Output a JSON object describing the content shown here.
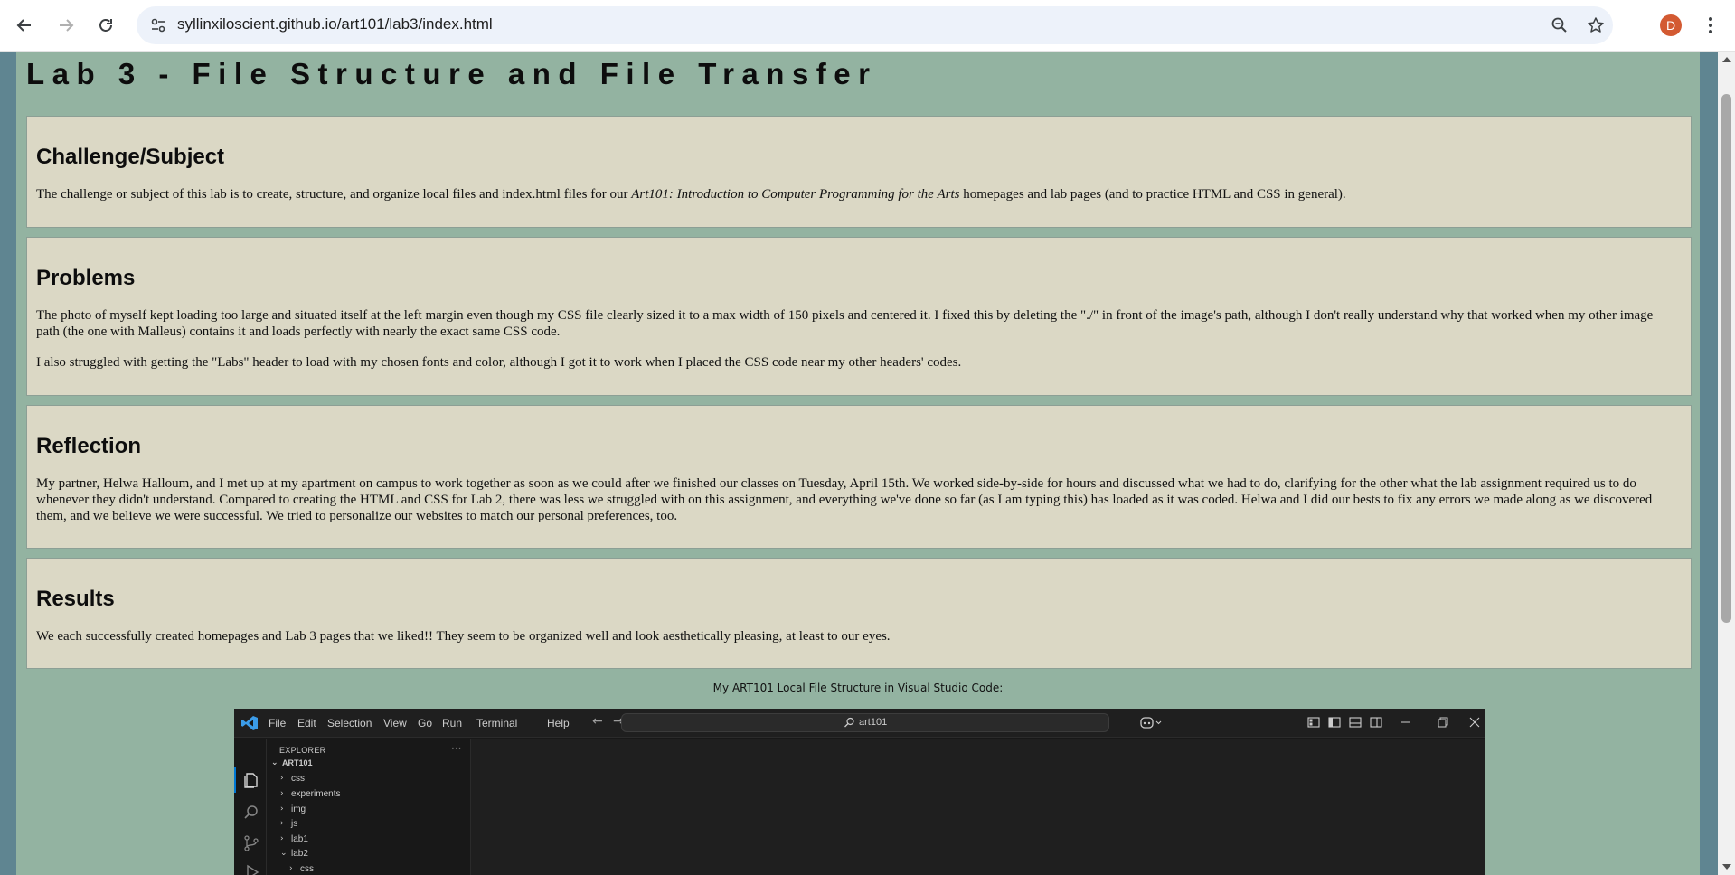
{
  "browser": {
    "url": "syllinxiloscient.github.io/art101/lab3/index.html",
    "profile_initial": "D",
    "icons": {
      "back": "arrow-back-icon",
      "forward": "arrow-forward-icon",
      "reload": "reload-icon",
      "site_info": "tune-icon",
      "zoom": "zoom-icon",
      "bookmark": "star-icon",
      "menu": "kebab-menu-icon"
    }
  },
  "page": {
    "title": "Lab 3 - File Structure and File Transfer",
    "colors": {
      "background": "#93b3a1",
      "section": "#dbd8c5",
      "outer": "#5f8591"
    },
    "sections": [
      {
        "heading": "Challenge/Subject",
        "paragraphs": [
          {
            "before": "The challenge or subject of this lab is to create, structure, and organize local files and index.html files for our ",
            "emphasis": "Art101: Introduction to Computer Programming for the Arts",
            "after": " homepages and lab pages (and to practice HTML and CSS in general)."
          }
        ]
      },
      {
        "heading": "Problems",
        "paragraphs": [
          "The photo of myself kept loading too large and situated itself at the left margin even though my CSS file clearly sized it to a max width of 150 pixels and centered it. I fixed this by deleting the \"./\" in front of the image's path, although I don't really understand why that worked when my other image path (the one with Malleus) contains it and loads perfectly with nearly the exact same CSS code.",
          "I also struggled with getting the \"Labs\" header to load with my chosen fonts and color, although I got it to work when I placed the CSS code near my other headers' codes."
        ]
      },
      {
        "heading": "Reflection",
        "paragraphs": [
          "My partner, Helwa Halloum, and I met up at my apartment on campus to work together as soon as we could after we finished our classes on Tuesday, April 15th. We worked side-by-side for hours and discussed what we had to do, clarifying for the other what the lab assignment required us to do whenever they didn't understand. Compared to creating the HTML and CSS for Lab 2, there was less we struggled with on this assignment, and everything we've done so far (as I am typing this) has loaded as it was coded. Helwa and I did our bests to fix any errors we made along as we discovered them, and we believe we were successful. We tried to personalize our websites to match our personal preferences, too."
        ]
      },
      {
        "heading": "Results",
        "paragraphs": [
          "We each successfully created homepages and Lab 3 pages that we liked!! They seem to be organized well and look aesthetically pleasing, at least to our eyes."
        ]
      }
    ],
    "caption": "My ART101 Local File Structure in Visual Studio Code:"
  },
  "vscode": {
    "menu": [
      "File",
      "Edit",
      "Selection",
      "View",
      "Go",
      "Run",
      "Terminal",
      "Help"
    ],
    "search_text": "art101",
    "explorer_label": "EXPLORER",
    "more": "···",
    "root_folder": "ART101",
    "tree": [
      {
        "name": "css",
        "expanded": false
      },
      {
        "name": "experiments",
        "expanded": false
      },
      {
        "name": "img",
        "expanded": false
      },
      {
        "name": "js",
        "expanded": false
      },
      {
        "name": "lab1",
        "expanded": false
      },
      {
        "name": "lab2",
        "expanded": true
      },
      {
        "name": "css",
        "expanded": false,
        "child": true
      }
    ]
  }
}
